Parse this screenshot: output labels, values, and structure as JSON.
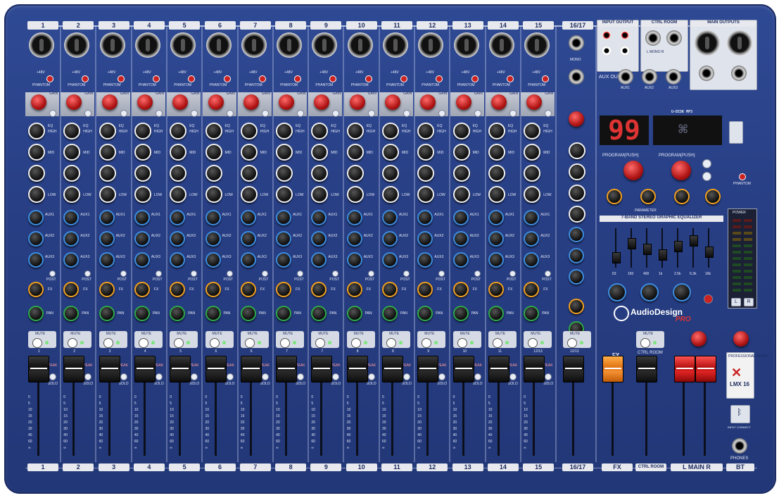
{
  "brand": {
    "name": "AudioDesign",
    "sub": "PRO",
    "model": "LMX 16",
    "tagline": "PROFESSIONAL MIXER"
  },
  "channels": [
    "1",
    "2",
    "3",
    "4",
    "5",
    "6",
    "7",
    "8",
    "9",
    "10",
    "11",
    "12",
    "13",
    "14",
    "15"
  ],
  "stereo_channel": "16/17",
  "labels": {
    "phantom": "PHANTOM",
    "plus48v": "+48V",
    "gain": "GAIN",
    "eq": "EQ",
    "high": "HIGH",
    "mid": "MID",
    "low": "LOW",
    "aux1": "AUX1",
    "aux2": "AUX2",
    "aux3": "AUX3",
    "fx": "FX",
    "pan": "PAN",
    "mute": "MUTE",
    "peak": "PEAK",
    "solo": "SOLO",
    "post": "POST",
    "mono": "MONO"
  },
  "fader_scale": [
    "10",
    "5",
    "0",
    "5",
    "10",
    "15",
    "20",
    "30",
    "40",
    "60",
    "∞"
  ],
  "top_sections": {
    "input_output": "INPUT  OUTPUT",
    "ctrl_room": "CTRL ROOM",
    "main_outputs": "MAIN OUTPUTS",
    "l_mono_r": "L  MONO  R",
    "aux_out": "AUX OUT",
    "aux_jacks": [
      "AUX1",
      "AUX2",
      "AUX3"
    ]
  },
  "fx_display": "99",
  "usb_label": "U-DISK MP3",
  "program1": "PROGRAM(PUSH)",
  "program2": "PROGRAM(PUSH)",
  "parameter": "PARAMETER",
  "geq_title": "7-BAND STEREO GRAPHIC EQUALIZER",
  "geq_bands": [
    "63",
    "160",
    "400",
    "1k",
    "2.5k",
    "6.3k",
    "16k"
  ],
  "geq_levels": [
    -3,
    2,
    0,
    -2,
    1,
    3,
    -1
  ],
  "bottom_labels": {
    "fx": "FX",
    "ctrl_room": "CTRL ROOM",
    "main": "L  MAIN  R",
    "bt": "BT",
    "phones": "PHONES",
    "stereo": "16/17",
    "bt_connect": "INPUT CONNECT"
  },
  "strip_fader_labels_top": [
    "1",
    "2",
    "3",
    "4",
    "5",
    "6",
    "6",
    "7",
    "7",
    "8",
    "8",
    "9",
    "10",
    "11",
    "12/13"
  ],
  "meter": {
    "title": "POWER",
    "lr": [
      "L",
      "R"
    ]
  },
  "colors": {
    "panel": "#283f85",
    "fx_fader": "#f08020",
    "main_fader": "#d91e1e"
  }
}
